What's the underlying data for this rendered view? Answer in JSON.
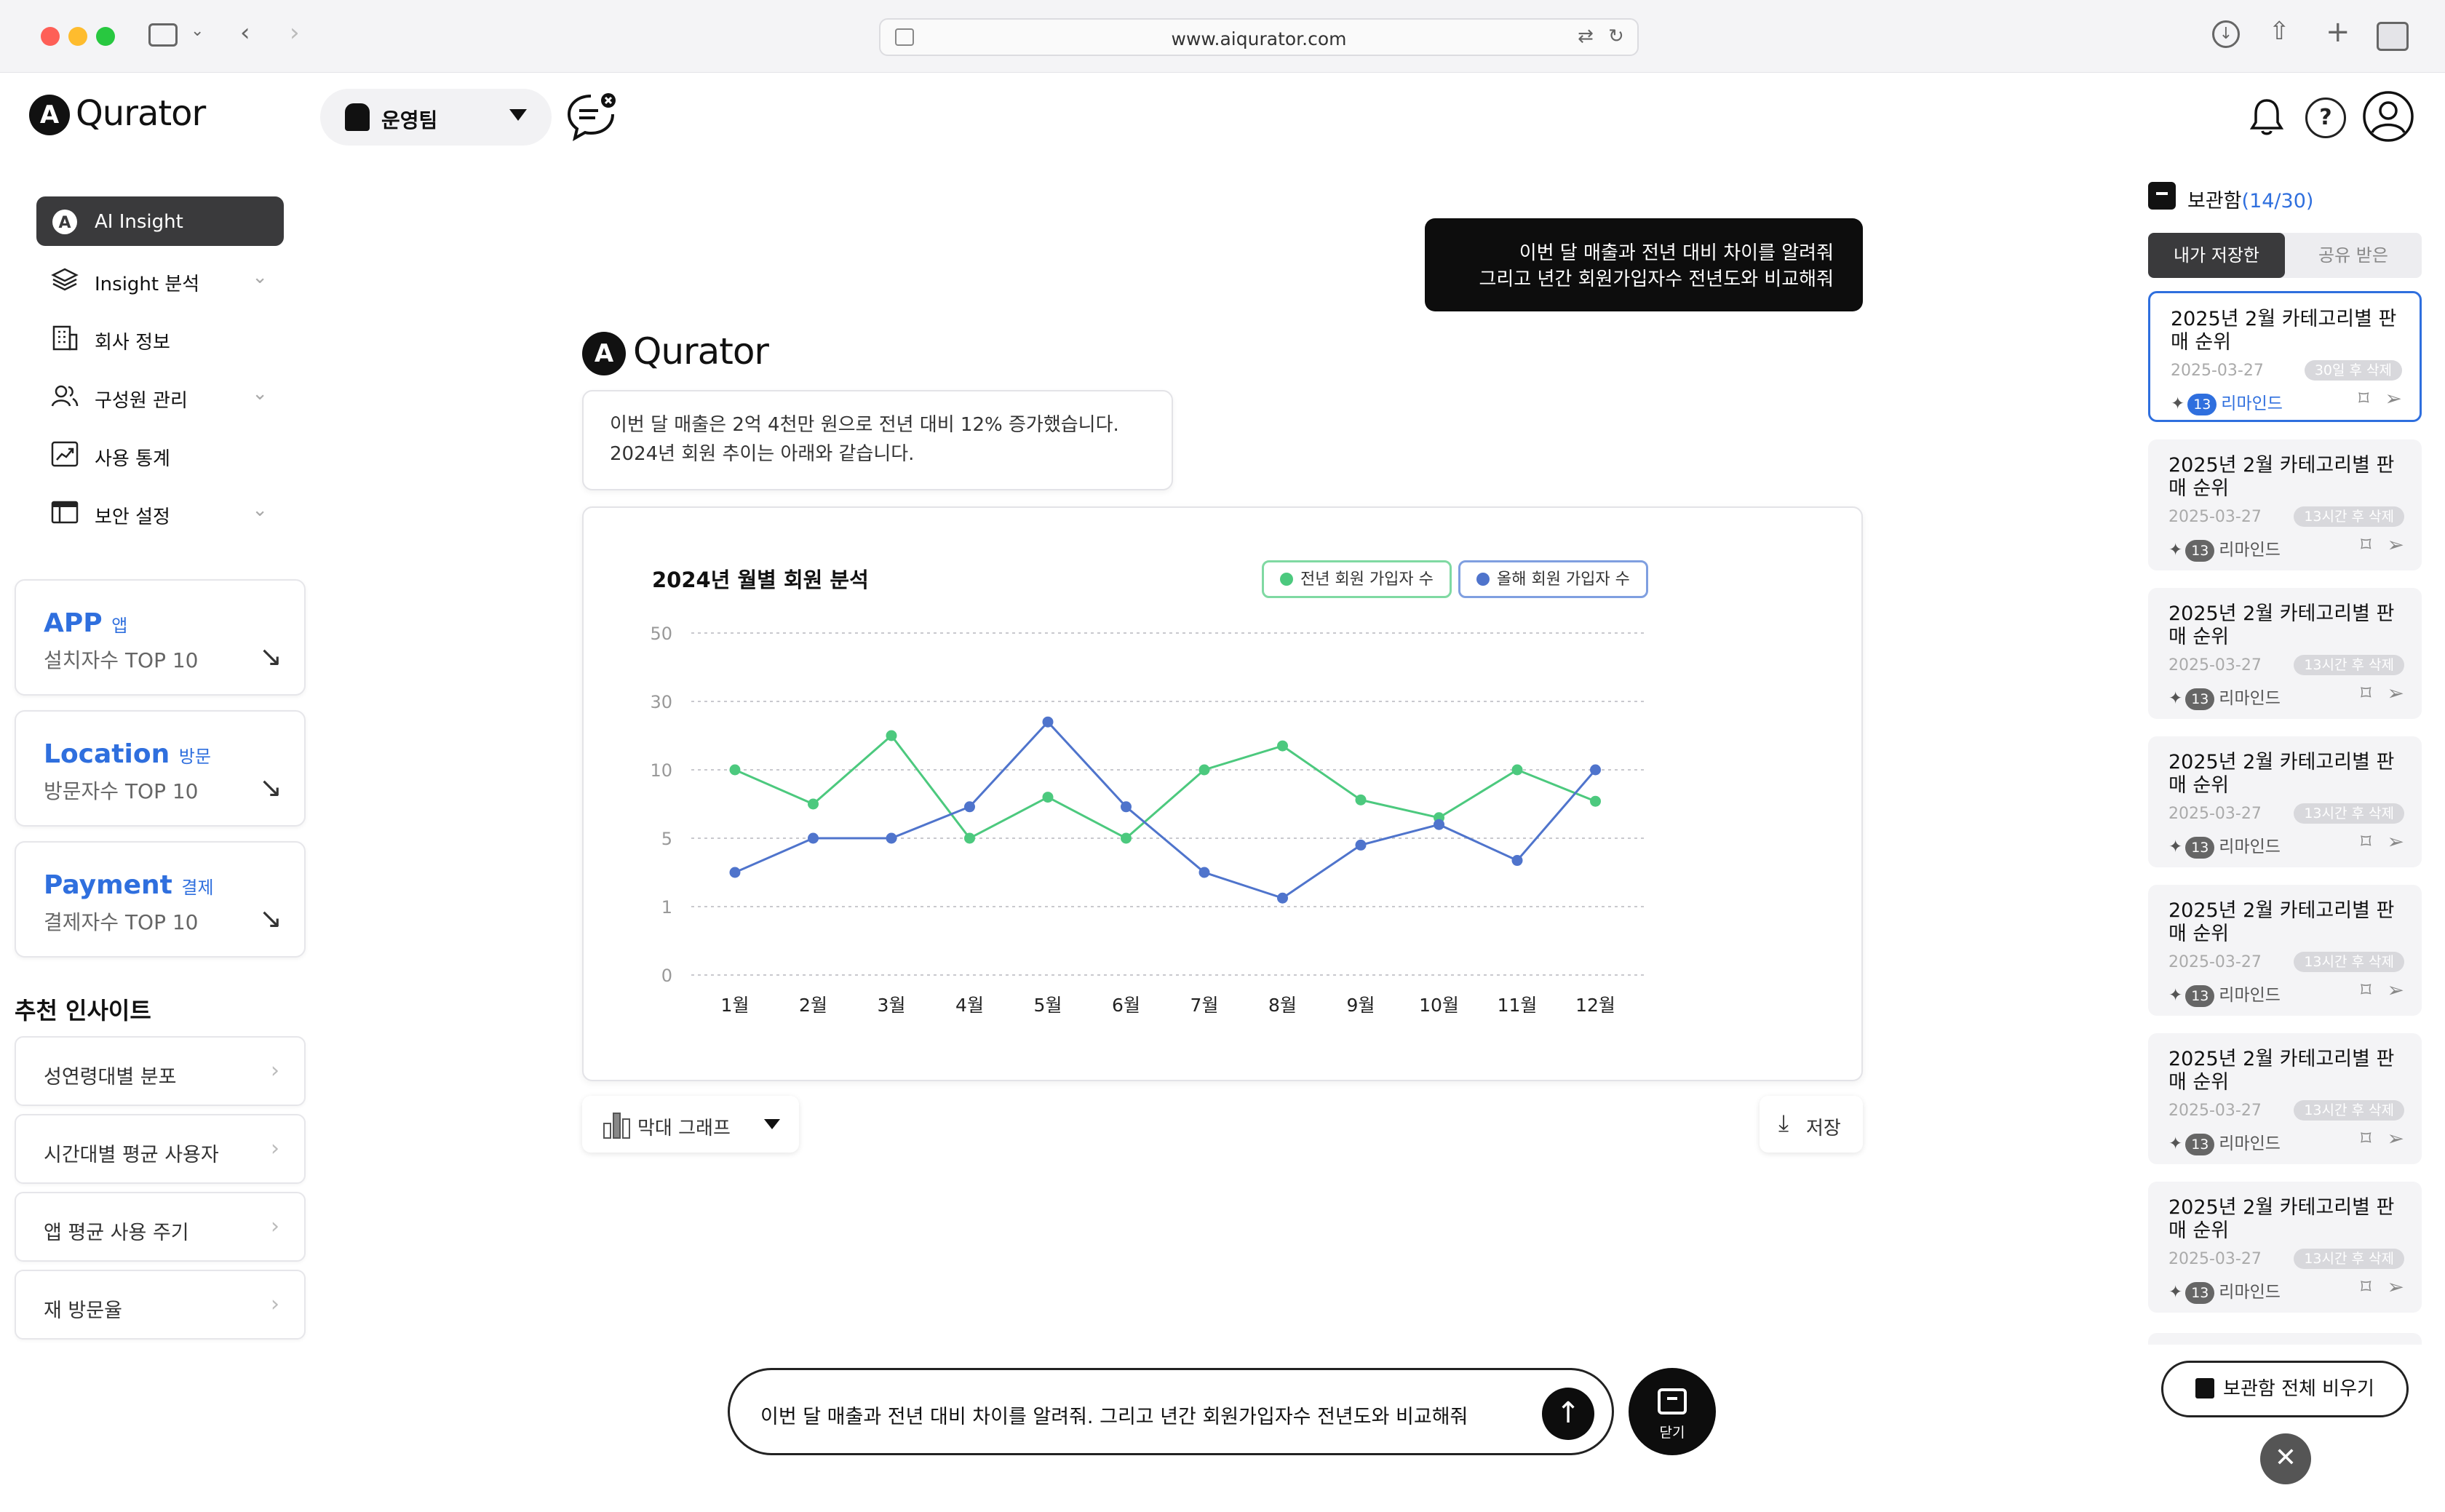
{
  "browser": {
    "url": "www.aiqurator.com"
  },
  "header": {
    "logo_mark": "A",
    "logo_text": "Qurator",
    "team": "운영팀"
  },
  "nav": {
    "items": [
      {
        "label": "AI Insight",
        "icon": "brand-icon",
        "active": true,
        "expandable": false
      },
      {
        "label": "Insight 분석",
        "icon": "layers-icon",
        "active": false,
        "expandable": true
      },
      {
        "label": "회사 정보",
        "icon": "building-icon",
        "active": false,
        "expandable": false
      },
      {
        "label": "구성원 관리",
        "icon": "users-icon",
        "active": false,
        "expandable": true
      },
      {
        "label": "사용 통계",
        "icon": "trend-icon",
        "active": false,
        "expandable": false
      },
      {
        "label": "보안 설정",
        "icon": "window-icon",
        "active": false,
        "expandable": true
      }
    ]
  },
  "tiles": [
    {
      "title": "APP",
      "tag": "앱",
      "subtitle": "설치자수 TOP 10"
    },
    {
      "title": "Location",
      "tag": "방문",
      "subtitle": "방문자수 TOP 10"
    },
    {
      "title": "Payment",
      "tag": "결제",
      "subtitle": "결제자수 TOP 10"
    }
  ],
  "recommend": {
    "title": "추천 인사이트",
    "items": [
      "성연령대별 분포",
      "시간대별 평균 사용자",
      "앱 평균 사용 주기",
      "재 방문율"
    ]
  },
  "conversation": {
    "question_line1": "이번 달 매출과 전년 대비 차이를 알려줘",
    "question_line2": "그리고 년간 회원가입자수 전년도와 비교해줘",
    "answer_line1": "이번 달 매출은 2억 4천만 원으로 전년 대비 12% 증가했습니다.",
    "answer_line2": "2024년 회원 추이는 아래와 같습니다."
  },
  "chart_data": {
    "type": "line",
    "title": "2024년 월별 회원 분석",
    "categories": [
      "1월",
      "2월",
      "3월",
      "4월",
      "5월",
      "6월",
      "7월",
      "8월",
      "9월",
      "10월",
      "11월",
      "12월"
    ],
    "y_ticks": [
      "50",
      "30",
      "10",
      "5",
      "1",
      "0"
    ],
    "y_tick_values": [
      50,
      30,
      10,
      5,
      1,
      0
    ],
    "scale": "custom-stepped (evenly spaced ticks)",
    "grid": true,
    "legend_position": "top-right",
    "series": [
      {
        "name": "전년 회원 가입자 수",
        "color": "#4cc97e",
        "values": [
          10,
          7.5,
          20,
          5,
          8,
          5,
          10,
          17,
          7.8,
          6.5,
          10,
          7.7
        ]
      },
      {
        "name": "올해 회원 가입자 수",
        "color": "#4f74cc",
        "values": [
          3,
          5,
          5,
          7.3,
          24,
          7.3,
          3,
          1.5,
          4.6,
          6,
          3.7,
          10
        ]
      }
    ]
  },
  "chart_controls": {
    "type_label": "막대 그래프",
    "save_label": "저장"
  },
  "chat": {
    "input_value": "이번 달 매출과 전년 대비 차이를 알려줘. 그리고 년간 회원가입자수 전년도와 비교해줘",
    "close_label": "닫기"
  },
  "archive": {
    "title": "보관함",
    "count": "(14/30)",
    "tab_mine": "내가 저장한",
    "tab_shared": "공유 받은",
    "remind_label": "리마인드",
    "cards": [
      {
        "title": "2025년 2월 카테고리별 판매 순위",
        "date": "2025-03-27",
        "badge": "30일 후 삭제",
        "count": "13",
        "selected": true
      },
      {
        "title": "2025년 2월 카테고리별 판매 순위",
        "date": "2025-03-27",
        "badge": "13시간 후 삭제",
        "count": "13",
        "selected": false
      },
      {
        "title": "2025년 2월 카테고리별 판매 순위",
        "date": "2025-03-27",
        "badge": "13시간 후 삭제",
        "count": "13",
        "selected": false
      },
      {
        "title": "2025년 2월 카테고리별 판매 순위",
        "date": "2025-03-27",
        "badge": "13시간 후 삭제",
        "count": "13",
        "selected": false
      },
      {
        "title": "2025년 2월 카테고리별 판매 순위",
        "date": "2025-03-27",
        "badge": "13시간 후 삭제",
        "count": "13",
        "selected": false
      },
      {
        "title": "2025년 2월 카테고리별 판매 순위",
        "date": "2025-03-27",
        "badge": "13시간 후 삭제",
        "count": "13",
        "selected": false
      },
      {
        "title": "2025년 2월 카테고리별 판매 순위",
        "date": "2025-03-27",
        "badge": "13시간 후 삭제",
        "count": "13",
        "selected": false
      }
    ],
    "empty_all_label": "보관함 전체 비우기"
  }
}
